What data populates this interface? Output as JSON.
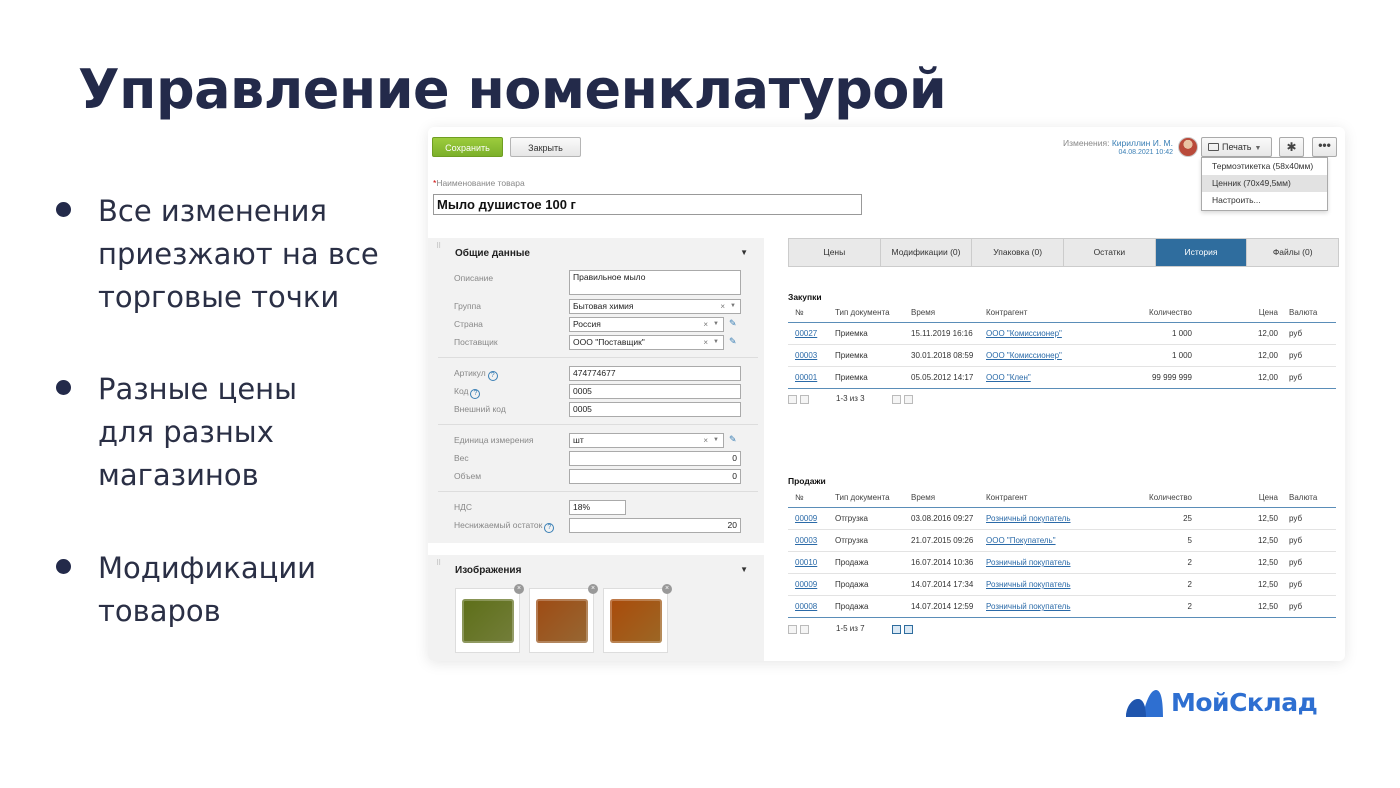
{
  "slide": {
    "title": "Управление номенклатурой",
    "bullets": [
      {
        "lines": [
          "Все изменения",
          "приезжают на все",
          "торговые точки"
        ]
      },
      {
        "lines": [
          "Разные цены",
          "для разных",
          "магазинов"
        ]
      },
      {
        "lines": [
          "Модификации",
          "товаров"
        ]
      }
    ],
    "logo_text": "МойСклад",
    "brand_color": "#2e6fd1"
  },
  "app": {
    "toolbar": {
      "save_label": "Сохранить",
      "close_label": "Закрыть",
      "changed_label": "Изменения:",
      "changed_user": "Кириллин И. М.",
      "changed_date": "04.08.2021 10:42",
      "print_label": "Печать",
      "gear_icon": "gear-icon",
      "more_label": "•••"
    },
    "print_menu": [
      {
        "label": "Термоэтикетка (58х40мм)",
        "active": false
      },
      {
        "label": "Ценник (70х49,5мм)",
        "active": true
      },
      {
        "label": "Настроить...",
        "active": false
      }
    ],
    "name_field": {
      "label": "Наименование товара",
      "value": "Мыло душистое 100 г"
    },
    "general": {
      "title": "Общие данные",
      "description_label": "Описание",
      "description_value": "Правильное мыло",
      "group_label": "Группа",
      "group_value": "Бытовая химия",
      "country_label": "Страна",
      "country_value": "Россия",
      "supplier_label": "Поставщик",
      "supplier_value": "ООО \"Поставщик\"",
      "article_label": "Артикул",
      "article_value": "474774677",
      "code_label": "Код",
      "code_value": "0005",
      "ext_code_label": "Внешний код",
      "ext_code_value": "0005",
      "unit_label": "Единица измерения",
      "unit_value": "шт",
      "weight_label": "Вес",
      "weight_value": "0",
      "volume_label": "Объем",
      "volume_value": "0",
      "vat_label": "НДС",
      "vat_value": "18%",
      "min_stock_label": "Неснижаемый остаток",
      "min_stock_value": "20"
    },
    "images": {
      "title": "Изображения",
      "items": [
        {
          "name": "soap-image-1",
          "color": "#9aa84e"
        },
        {
          "name": "soap-image-2",
          "color": "#c98a45"
        },
        {
          "name": "soap-image-3",
          "color": "#d08a32"
        }
      ]
    },
    "tabs": [
      {
        "label": "Цены",
        "active": false
      },
      {
        "label": "Модификации (0)",
        "active": false
      },
      {
        "label": "Упаковка (0)",
        "active": false
      },
      {
        "label": "Остатки",
        "active": false
      },
      {
        "label": "История",
        "active": true
      },
      {
        "label": "Файлы (0)",
        "active": false
      }
    ],
    "columns": [
      "№",
      "Тип документа",
      "Время",
      "Контрагент",
      "Количество",
      "Цена",
      "Валюта"
    ],
    "purchases": {
      "title": "Закупки",
      "rows": [
        [
          "00027",
          "Приемка",
          "15.11.2019 16:16",
          "ООО \"Комиссионер\"",
          "1 000",
          "12,00",
          "руб"
        ],
        [
          "00003",
          "Приемка",
          "30.01.2018 08:59",
          "ООО \"Комиссионер\"",
          "1 000",
          "12,00",
          "руб"
        ],
        [
          "00001",
          "Приемка",
          "05.05.2012 14:17",
          "ООО \"Клен\"",
          "99 999 999",
          "12,00",
          "руб"
        ]
      ],
      "pager": "1-3 из 3"
    },
    "sales": {
      "title": "Продажи",
      "rows": [
        [
          "00009",
          "Отгрузка",
          "03.08.2016 09:27",
          "Розничный покупатель",
          "25",
          "12,50",
          "руб"
        ],
        [
          "00003",
          "Отгрузка",
          "21.07.2015 09:26",
          "ООО \"Покупатель\"",
          "5",
          "12,50",
          "руб"
        ],
        [
          "00010",
          "Продажа",
          "16.07.2014 10:36",
          "Розничный покупатель",
          "2",
          "12,50",
          "руб"
        ],
        [
          "00009",
          "Продажа",
          "14.07.2014 17:34",
          "Розничный покупатель",
          "2",
          "12,50",
          "руб"
        ],
        [
          "00008",
          "Продажа",
          "14.07.2014 12:59",
          "Розничный покупатель",
          "2",
          "12,50",
          "руб"
        ]
      ],
      "pager": "1-5 из 7"
    }
  }
}
